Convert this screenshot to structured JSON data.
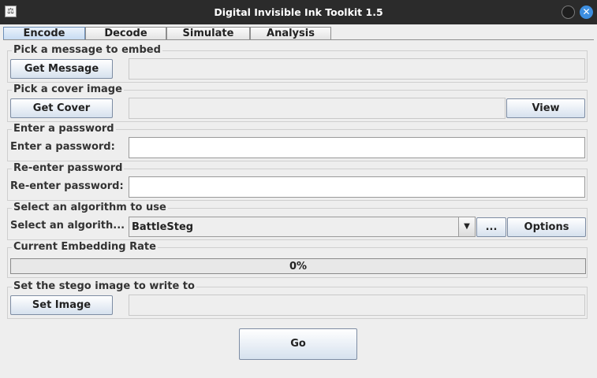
{
  "window": {
    "title": "Digital Invisible Ink Toolkit 1.5",
    "close_glyph": "✕",
    "icon_glyph": "⚖"
  },
  "tabs": [
    {
      "label": "Encode",
      "active": true
    },
    {
      "label": "Decode",
      "active": false
    },
    {
      "label": "Simulate",
      "active": false
    },
    {
      "label": "Analysis",
      "active": false
    }
  ],
  "message_section": {
    "title": "Pick a message to embed",
    "button": "Get Message",
    "path": ""
  },
  "cover_section": {
    "title": "Pick a cover image",
    "button": "Get Cover",
    "path": "",
    "view_button": "View"
  },
  "password_section": {
    "title": "Enter a password",
    "label": "Enter a password:",
    "value": ""
  },
  "reenter_section": {
    "title": "Re-enter password",
    "label": "Re-enter password:",
    "value": ""
  },
  "algorithm_section": {
    "title": "Select an algorithm to use",
    "label": "Select an algorith...",
    "selected": "BattleSteg",
    "more_button": "...",
    "options_button": "Options",
    "arrow_glyph": "▼"
  },
  "rate_section": {
    "title": "Current Embedding Rate",
    "progress_text": "0%",
    "progress_value": 0
  },
  "stego_section": {
    "title": "Set the stego image to write to",
    "button": "Set Image",
    "path": ""
  },
  "go_button": "Go"
}
